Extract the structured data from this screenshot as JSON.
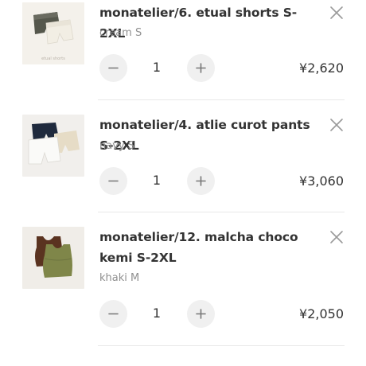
{
  "cart": {
    "items": [
      {
        "title": "monatelier/6. etual shorts S-2XL",
        "variant": "cream S",
        "quantity": "1",
        "price": "¥2,620",
        "thumb_caption": "etual shorts"
      },
      {
        "title": "monatelier/4. atlie curot pants S-2XL",
        "variant": "navy S",
        "quantity": "1",
        "price": "¥3,060"
      },
      {
        "title": "monatelier/12. malcha choco kemi S-2XL",
        "variant": "khaki M",
        "quantity": "1",
        "price": "¥2,050"
      }
    ]
  },
  "icons": {
    "remove": "close-icon",
    "decrease": "minus-icon",
    "increase": "plus-icon"
  },
  "colors": {
    "button_bg": "#f0f0f0",
    "text": "#333333",
    "muted": "#8f8f8f",
    "divider": "#e8e8e8"
  }
}
